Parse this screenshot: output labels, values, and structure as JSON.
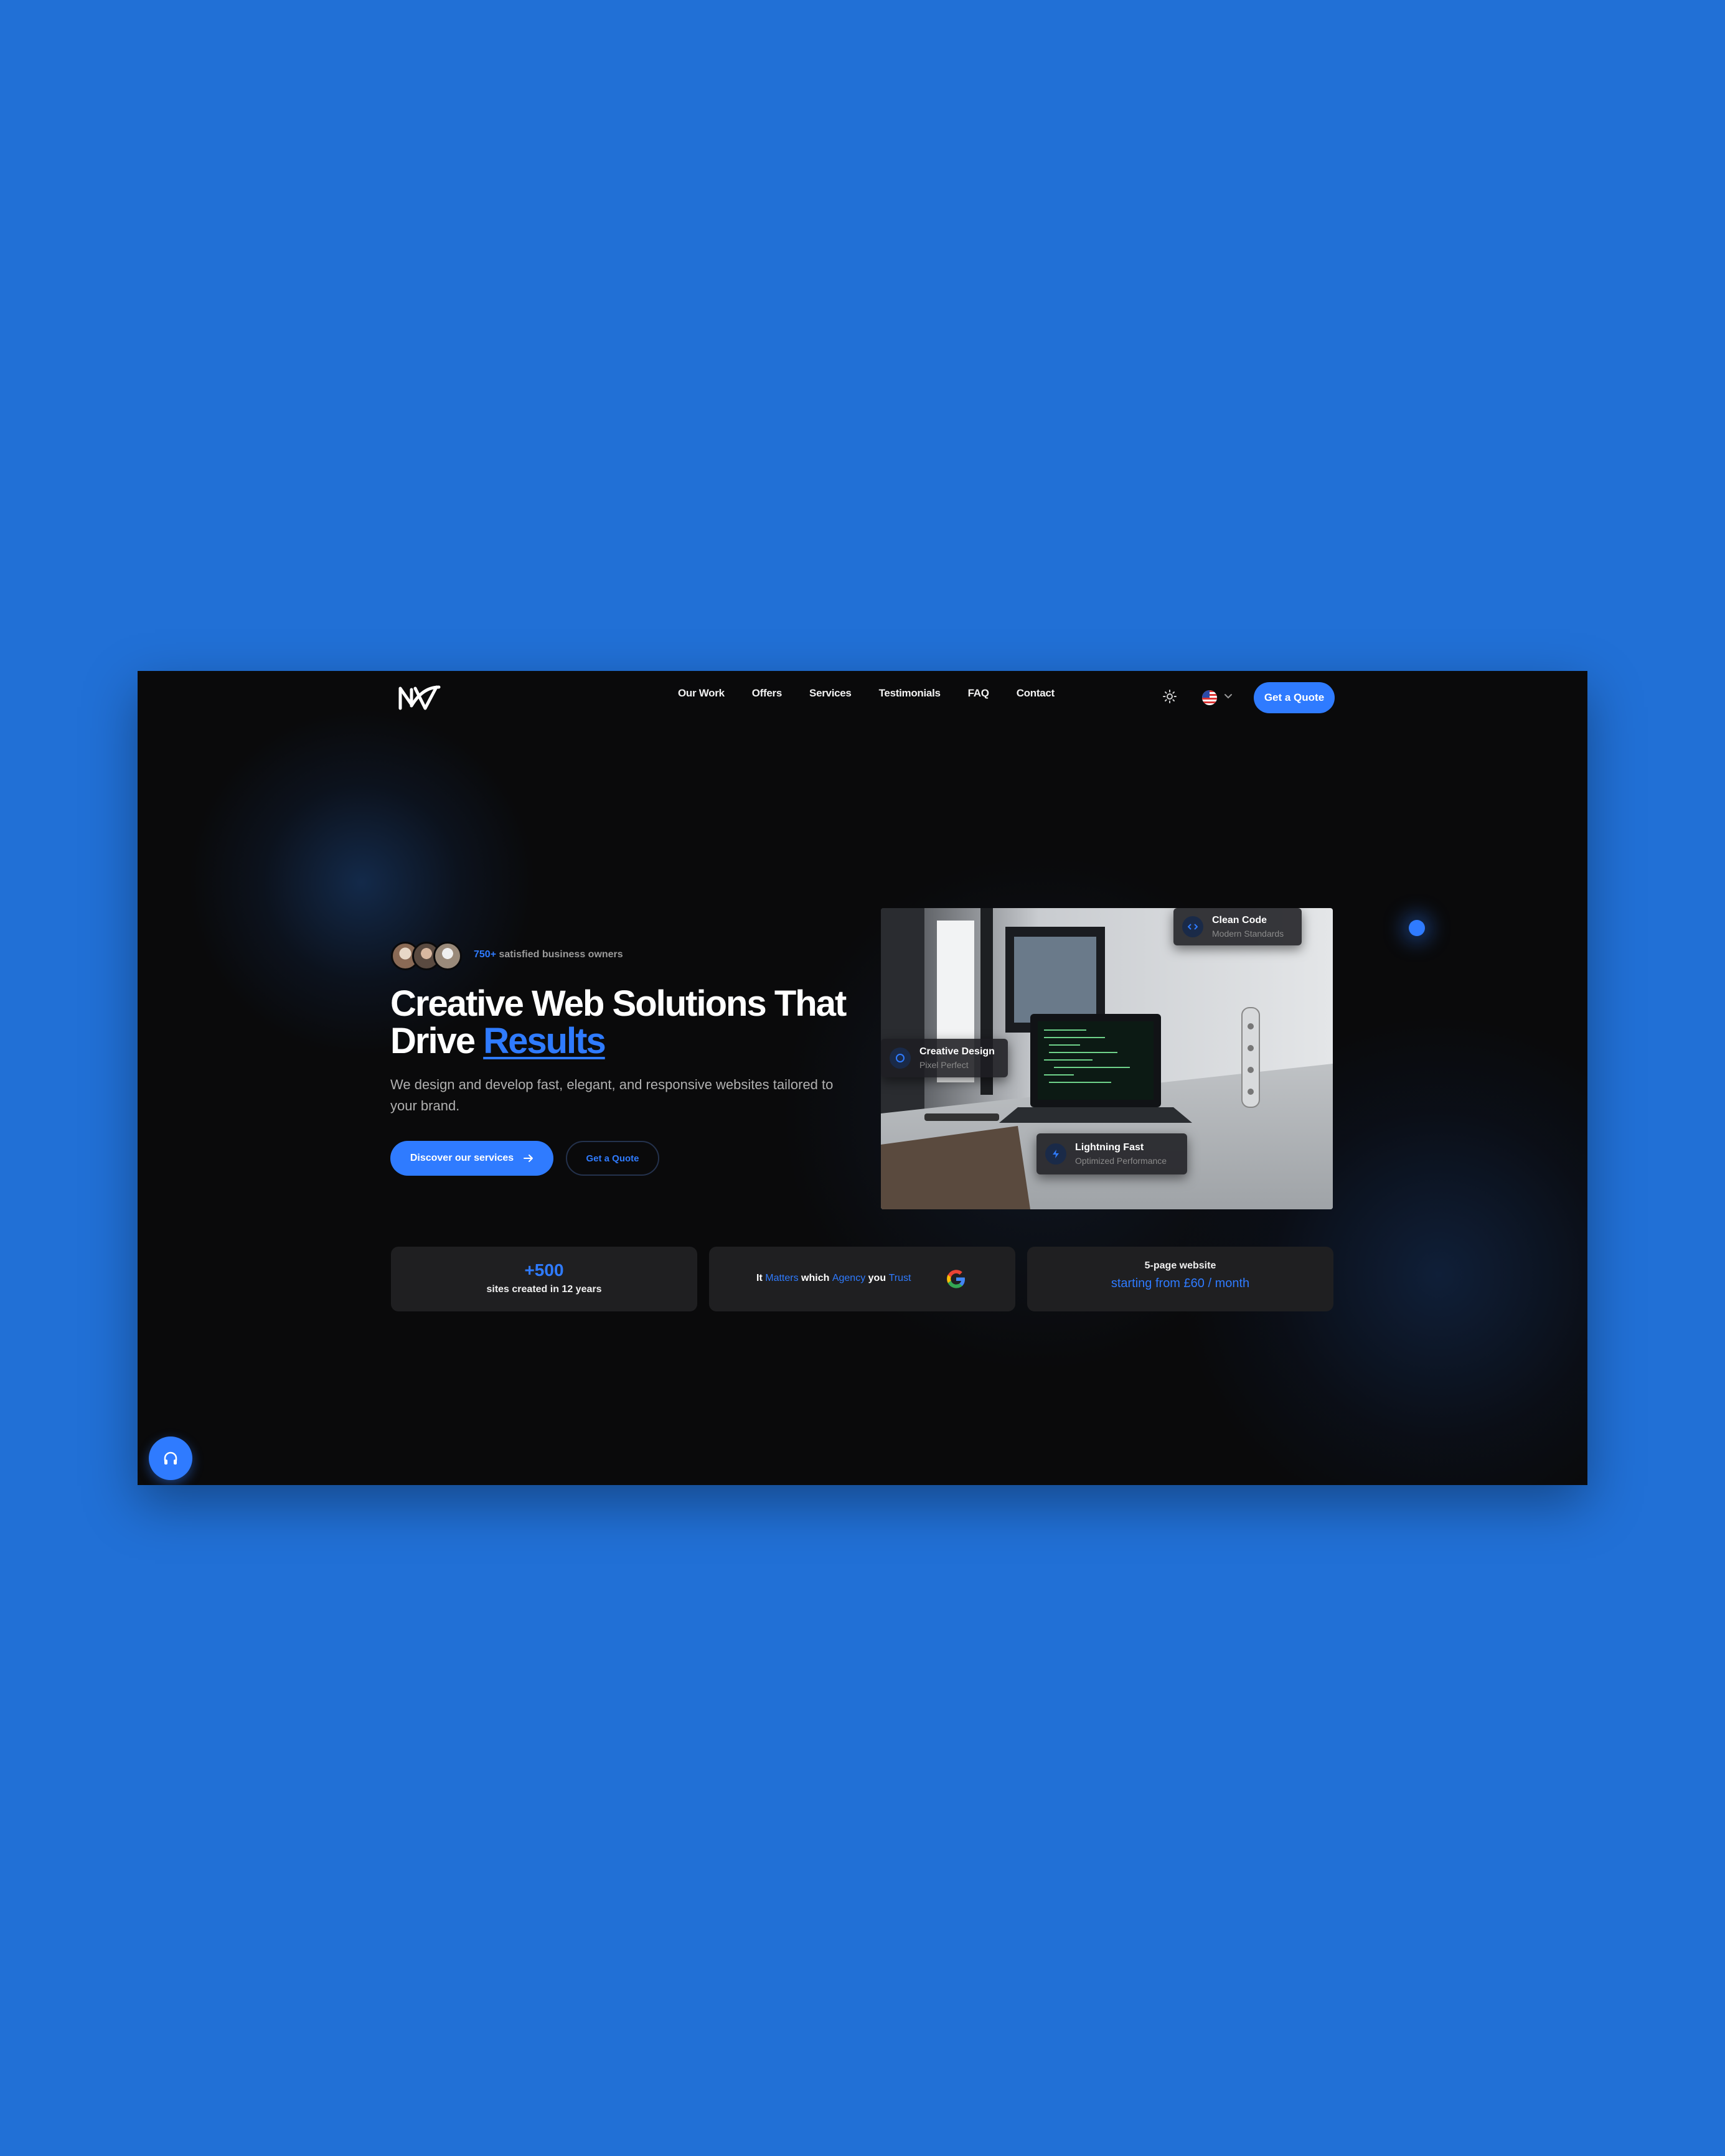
{
  "nav": {
    "menu": [
      {
        "label": "Our Work"
      },
      {
        "label": "Offers"
      },
      {
        "label": "Services"
      },
      {
        "label": "Testimonials"
      },
      {
        "label": "FAQ"
      },
      {
        "label": "Contact"
      }
    ],
    "cta_label": "Get a Quote",
    "icons": {
      "theme": "sun-icon",
      "language": "us-flag-icon",
      "dropdown": "chevron-down-icon"
    }
  },
  "hero": {
    "social_count": "750+",
    "social_text": "satisfied business owners",
    "headline_main": "Creative Web Solutions That Drive ",
    "headline_accent": "Results",
    "subtext": "We design and develop fast, elegant, and responsive websites tailored to your brand.",
    "primary_button": "Discover our services",
    "secondary_button": "Get a Quote",
    "badges": {
      "clean_code": {
        "title": "Clean Code",
        "subtitle": "Modern Standards"
      },
      "creative_design": {
        "title": "Creative Design",
        "subtitle": "Pixel Perfect"
      },
      "lightning_fast": {
        "title": "Lightning Fast",
        "subtitle": "Optimized Performance"
      }
    }
  },
  "stats": {
    "sites": {
      "value": "+500",
      "label": "sites created in 12 years"
    },
    "trust": {
      "w1": "It",
      "w2": "Matters",
      "w3": "which",
      "w4": "Agency",
      "w5": "you",
      "w6": "Trust"
    },
    "pricing": {
      "title": "5-page website",
      "price": "starting from £60 / month"
    }
  },
  "colors": {
    "accent": "#2f7bff",
    "background": "#0a0a0b",
    "card": "#1f1f21",
    "page_bg": "#2170d6"
  }
}
